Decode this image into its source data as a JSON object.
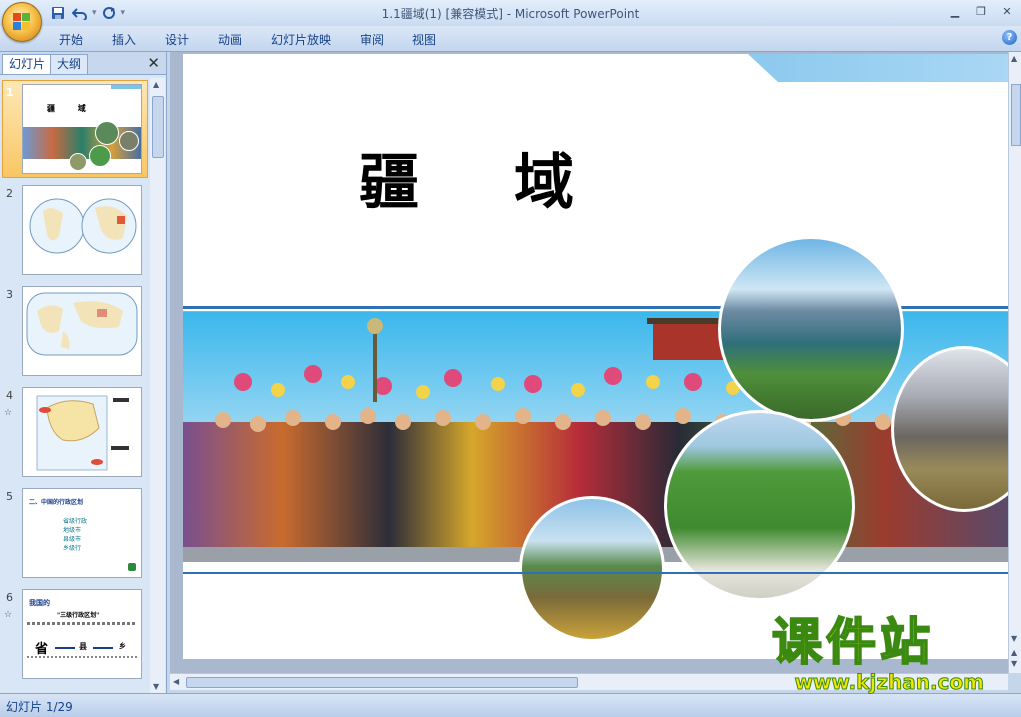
{
  "window": {
    "title": "1.1疆域(1) [兼容模式] - Microsoft PowerPoint"
  },
  "quick_access": {
    "icons": [
      "save-icon",
      "undo-icon",
      "redo-icon",
      "customize-icon"
    ]
  },
  "ribbon": {
    "tabs": [
      "开始",
      "插入",
      "设计",
      "动画",
      "幻灯片放映",
      "审阅",
      "视图"
    ]
  },
  "pane": {
    "tab_slides": "幻灯片",
    "tab_outline": "大纲",
    "close": "✕"
  },
  "thumbnails": {
    "items": [
      {
        "number": "1",
        "title": "疆  域",
        "selected": true
      },
      {
        "number": "2"
      },
      {
        "number": "3"
      },
      {
        "number": "4",
        "has_animation": true
      },
      {
        "number": "5",
        "heading": "二、中国的行政区划",
        "bullets": [
          "省级行政",
          "地级市",
          "县级市",
          "乡级行"
        ]
      },
      {
        "number": "6",
        "has_animation": true,
        "heading": "我国的",
        "subheading": "\"三级行政区划\"",
        "big": "省",
        "mid": "县",
        "small": "乡"
      }
    ]
  },
  "slide": {
    "title": "疆域",
    "title_char_1": "疆",
    "title_char_2": "域"
  },
  "status": {
    "slide_counter": "幻灯片 1/29"
  },
  "watermark": {
    "brand": "课件站",
    "url": "www.kjzhan.com"
  },
  "colors": {
    "accent_blue": "#15428b",
    "slide_band": "#2f6fb4",
    "selected_thumb": "#f9c664"
  }
}
